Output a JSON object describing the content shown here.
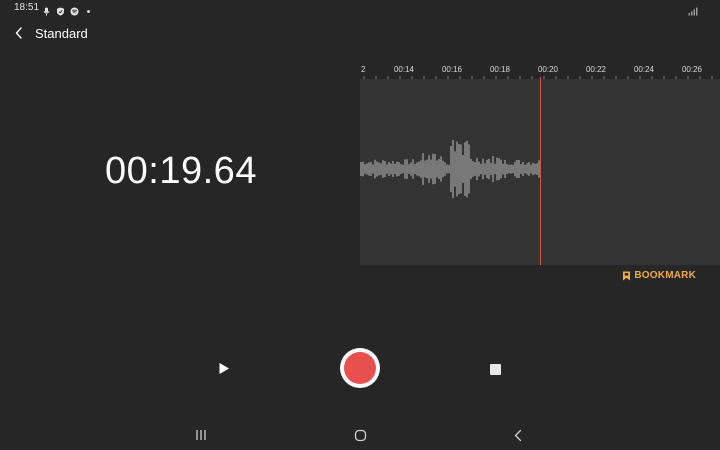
{
  "status_bar": {
    "time": "18:51",
    "icons": [
      "mic-icon",
      "shield-icon",
      "spotify-icon",
      "dot-icon"
    ],
    "right_icons": [
      "signal-icon"
    ]
  },
  "header": {
    "title": "Standard",
    "back_icon": "chevron-left-icon"
  },
  "recorder": {
    "elapsed": "00:19.64",
    "timeline_labels": [
      "2",
      "00:14",
      "00:16",
      "00:18",
      "00:20",
      "00:22",
      "00:24",
      "00:26"
    ],
    "bookmark_label": "BOOKMARK",
    "accent_color": "#f0a94a",
    "record_color": "#e8504f",
    "playhead_color": "#d9534a"
  },
  "controls": {
    "play_icon": "play-icon",
    "record_icon": "record-icon",
    "stop_icon": "stop-icon"
  },
  "nav": {
    "icons": [
      "recents-icon",
      "home-icon",
      "back-icon"
    ]
  }
}
